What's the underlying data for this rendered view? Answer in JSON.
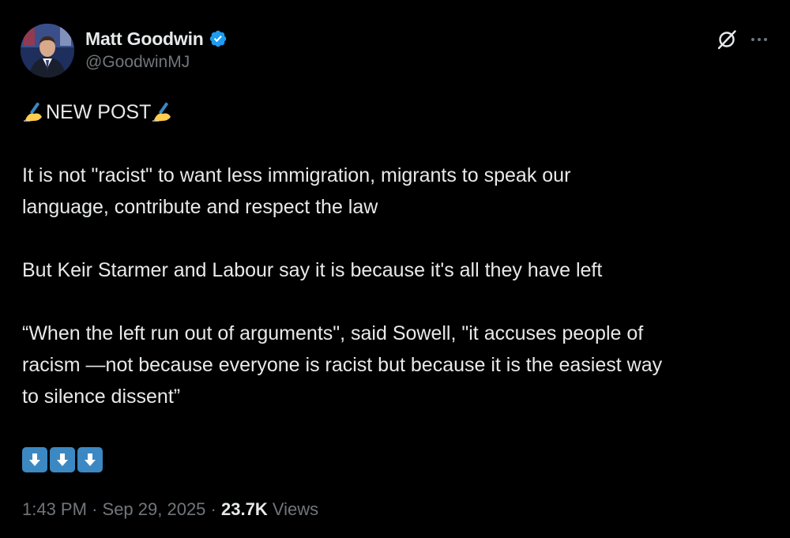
{
  "author": {
    "display_name": "Matt Goodwin",
    "handle": "@GoodwinMJ",
    "verified": true
  },
  "post": {
    "headline_prefix_icon": "writing-hand-emoji",
    "headline": "NEW POST",
    "headline_suffix_icon": "writing-hand-emoji",
    "paragraph_1_line_1": "It is not \"racist\" to want less immigration, migrants to speak our",
    "paragraph_1_line_2": "language, contribute and respect the law",
    "paragraph_2": "But Keir Starmer and Labour say it is because it's all they have left",
    "paragraph_3_line_1": "“When the left run out of arguments\", said Sowell, \"it accuses people of",
    "paragraph_3_line_2": "racism —not because everyone is racist but because it is the easiest way",
    "paragraph_3_line_3": "to silence dissent”",
    "trailing_icons": [
      "down-arrow-emoji",
      "down-arrow-emoji",
      "down-arrow-emoji"
    ]
  },
  "meta": {
    "time": "1:43 PM",
    "separator": "·",
    "date": "Sep 29, 2025",
    "views_count": "23.7K",
    "views_label": "Views"
  },
  "colors": {
    "background": "#000000",
    "text_primary": "#e7e9ea",
    "text_secondary": "#71767b",
    "verified_badge": "#1d9bf0",
    "arrow_emoji": "#3b88c3"
  }
}
